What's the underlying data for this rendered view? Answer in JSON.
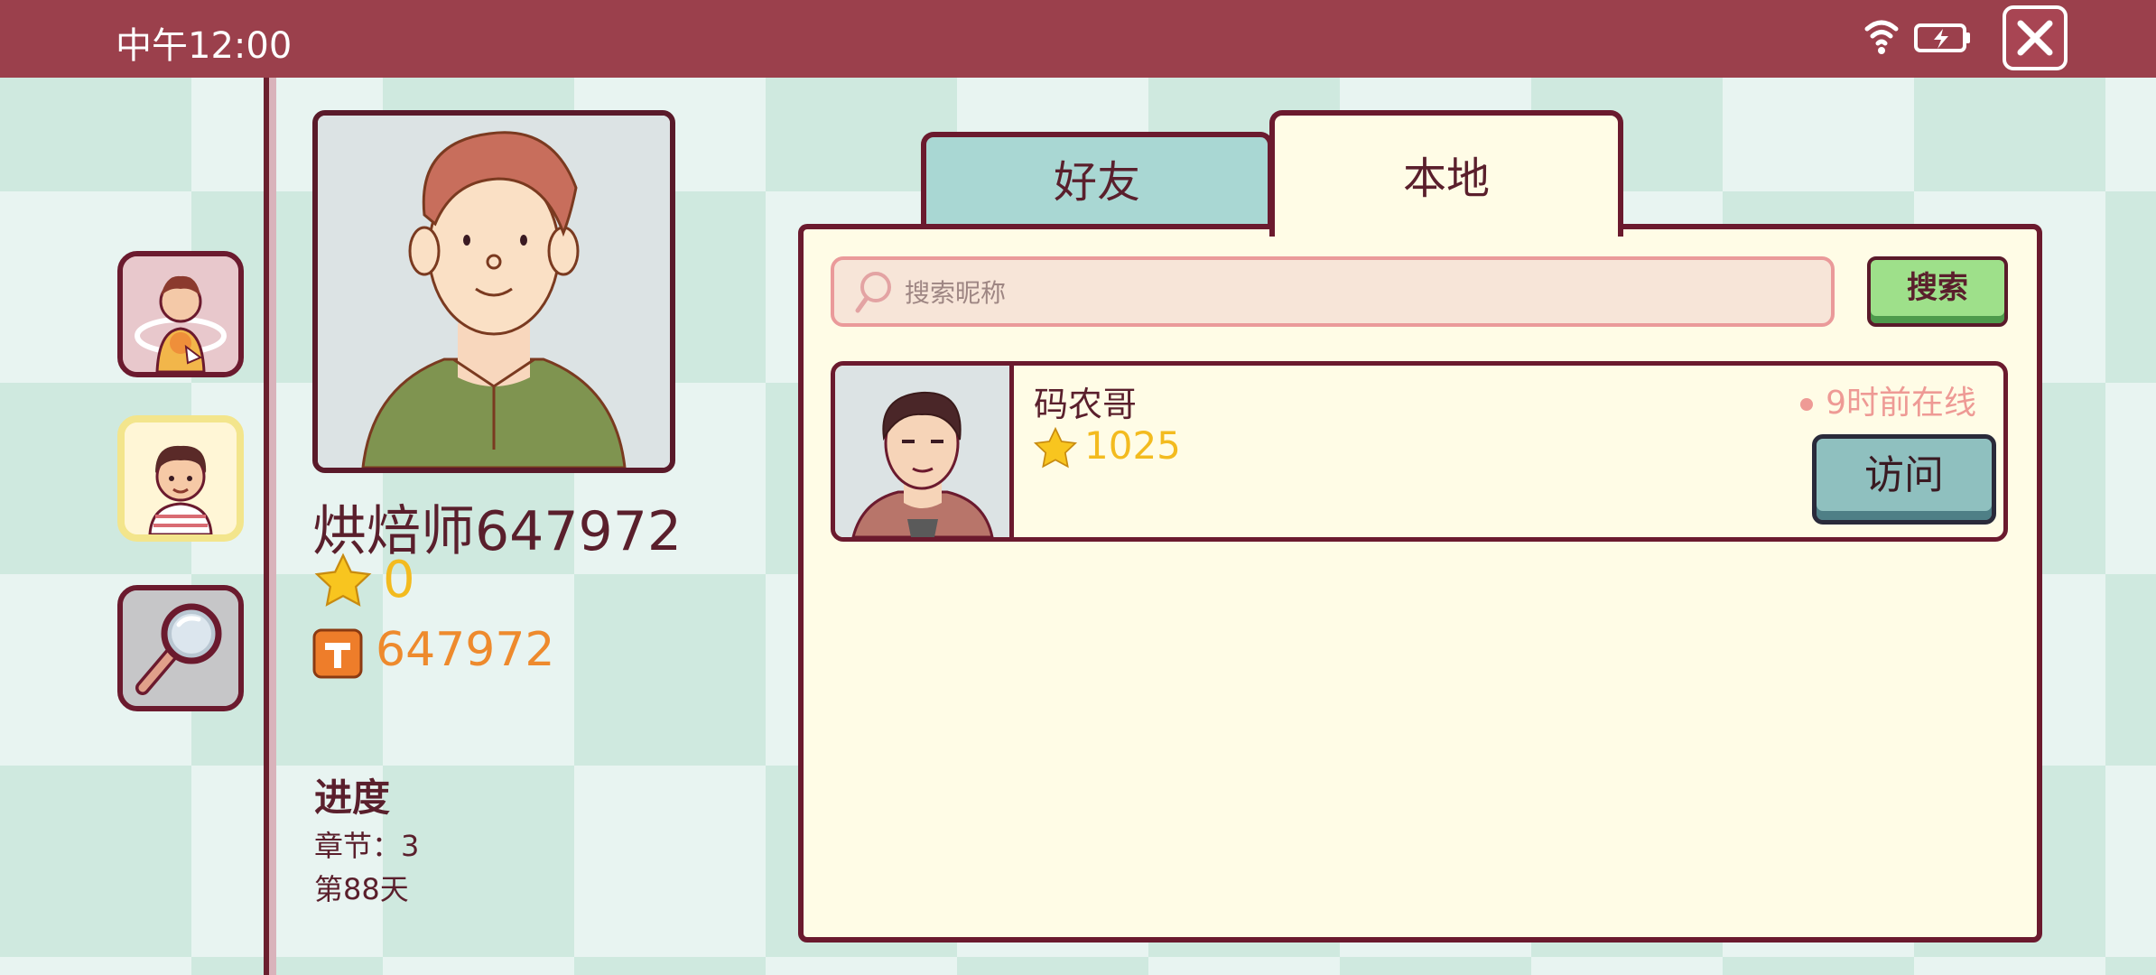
{
  "status_bar": {
    "time": "中午12:00",
    "icons": [
      "wifi-icon",
      "battery-icon"
    ],
    "close_icon": "close-icon"
  },
  "sidebar": {
    "items": [
      {
        "icon": "chef-pizza-icon"
      },
      {
        "icon": "boy-avatar-icon",
        "active": true
      },
      {
        "icon": "magnifier-icon"
      }
    ]
  },
  "profile": {
    "name": "烘焙师647972",
    "stars": "0",
    "code": "647972",
    "progress_title": "进度",
    "chapter": "章节：3",
    "day": "第88天"
  },
  "tabs": [
    {
      "label": "好友",
      "active": false
    },
    {
      "label": "本地",
      "active": true
    }
  ],
  "search": {
    "placeholder": "搜索昵称",
    "value": "",
    "button_label": "搜索"
  },
  "results": [
    {
      "name": "码农哥",
      "stars": "1025",
      "status": "9时前在线",
      "action_label": "访问"
    }
  ],
  "colors": {
    "topbar": "#9b404c",
    "border": "#6b1a2e",
    "star": "#f3bb1f",
    "code": "#ee8a2d",
    "panel": "#fffce6"
  }
}
